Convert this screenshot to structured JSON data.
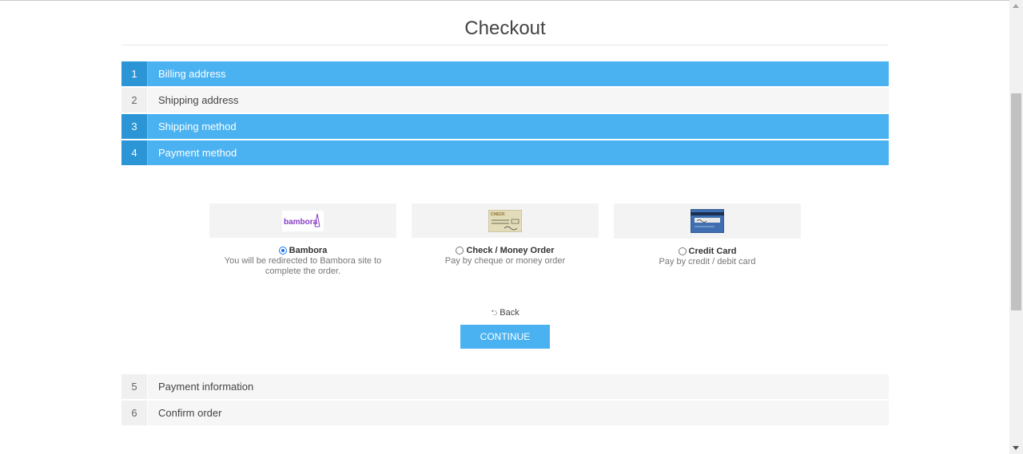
{
  "page": {
    "title": "Checkout"
  },
  "steps_top": [
    {
      "number": "1",
      "label": "Billing address",
      "state": "active"
    },
    {
      "number": "2",
      "label": "Shipping address",
      "state": "inactive"
    },
    {
      "number": "3",
      "label": "Shipping method",
      "state": "active"
    },
    {
      "number": "4",
      "label": "Payment method",
      "state": "active"
    }
  ],
  "payment_methods": [
    {
      "name": "Bambora",
      "description": "You will be redirected to Bambora site to complete the order.",
      "selected": true,
      "logo_text": "bambora",
      "icon": "bambora-logo-icon"
    },
    {
      "name": "Check / Money Order",
      "description": "Pay by cheque or money order",
      "selected": false,
      "logo_text": "CHECK",
      "icon": "check-logo-icon"
    },
    {
      "name": "Credit Card",
      "description": "Pay by credit / debit card",
      "selected": false,
      "icon": "credit-card-icon"
    }
  ],
  "actions": {
    "back_label": "Back",
    "back_icon": "back-arrow-icon",
    "continue_label": "CONTINUE"
  },
  "steps_bottom": [
    {
      "number": "5",
      "label": "Payment information",
      "state": "inactive"
    },
    {
      "number": "6",
      "label": "Confirm order",
      "state": "inactive"
    }
  ],
  "colors": {
    "accent": "#4ab2f1",
    "accent_dark": "#2b95d6",
    "inactive_bg": "#f6f6f6"
  }
}
